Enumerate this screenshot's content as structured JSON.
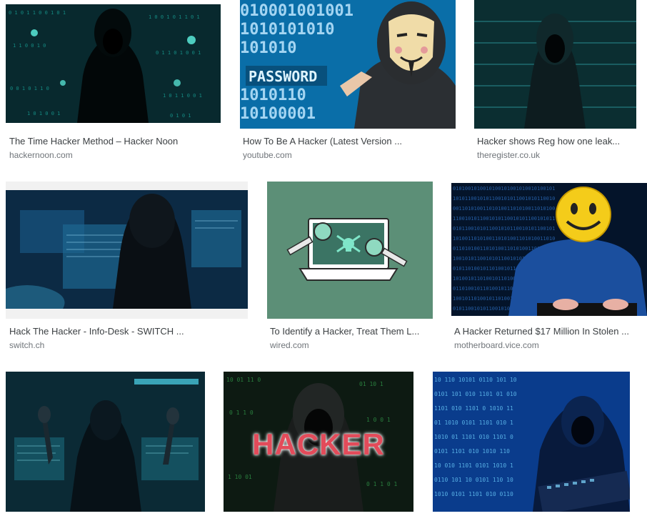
{
  "results": [
    {
      "title": "The Time Hacker Method – Hacker Noon",
      "source": "hackernoon.com",
      "image": "hooded-figure-green-code"
    },
    {
      "title": "How To Be A Hacker (Latest Version ...",
      "source": "youtube.com",
      "image": "guy-fawkes-mask-binary-password"
    },
    {
      "title": "Hacker shows Reg how one leak...",
      "source": "theregister.co.uk",
      "image": "hooded-figure-teal-dark"
    },
    {
      "title": "Hack The Hacker - Info-Desk - SWITCH ...",
      "source": "switch.ch",
      "image": "hooded-figure-monitors-blue"
    },
    {
      "title": "To Identify a Hacker, Treat Them L...",
      "source": "wired.com",
      "image": "laptop-skull-magnifiers"
    },
    {
      "title": "A Hacker Returned $17 Million In Stolen ...",
      "source": "motherboard.vice.com",
      "image": "smiley-face-hacker-binary"
    },
    {
      "image": "hooded-figure-hands-up-monitors"
    },
    {
      "image": "hacker-text-hooded-figure",
      "overlay_text": "HACKER"
    },
    {
      "image": "hooded-figure-blue-keyboard"
    }
  ]
}
